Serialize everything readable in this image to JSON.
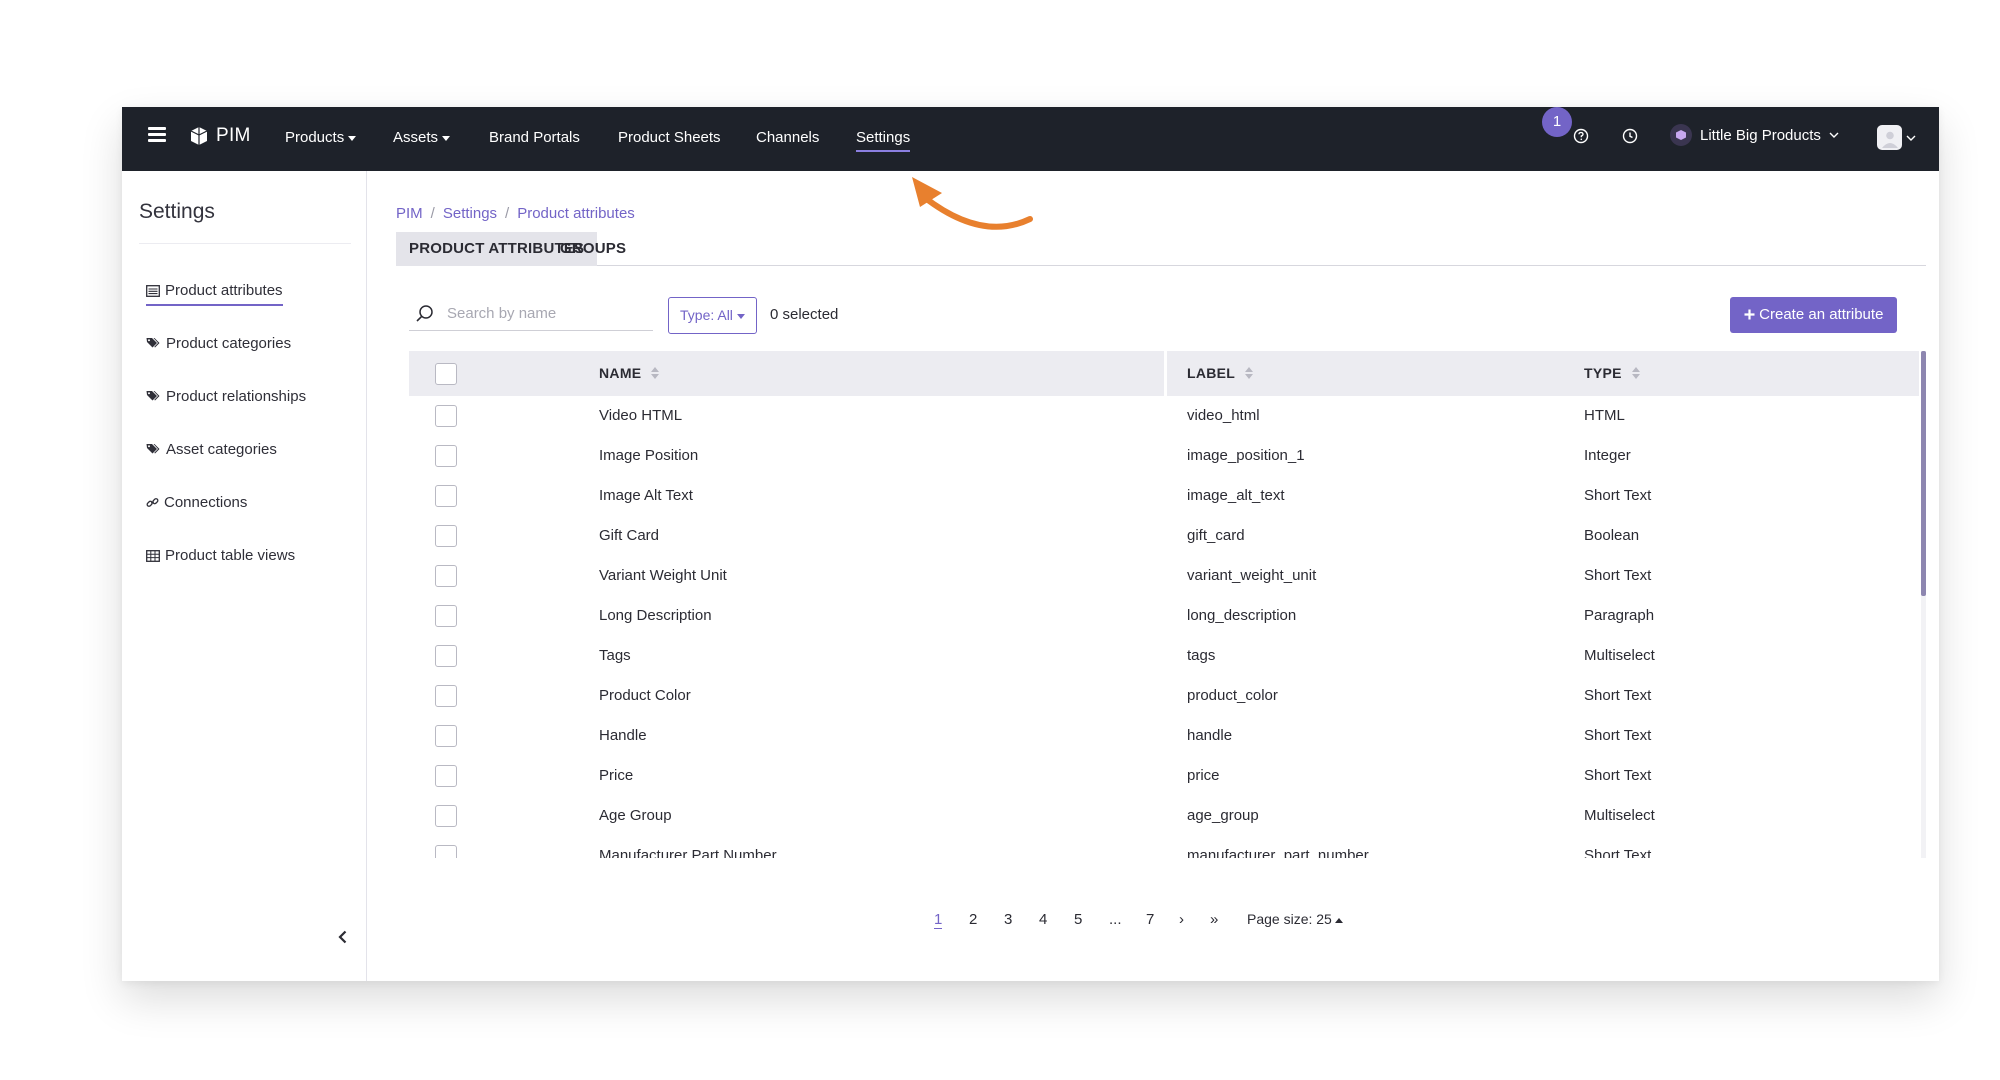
{
  "topnav": {
    "app_name": "PIM",
    "items": [
      {
        "label": "Products",
        "has_caret": true
      },
      {
        "label": "Assets",
        "has_caret": true
      },
      {
        "label": "Brand Portals"
      },
      {
        "label": "Product Sheets"
      },
      {
        "label": "Channels"
      },
      {
        "label": "Settings",
        "active": true
      }
    ],
    "notification_count": "1",
    "workspace": "Little Big Products",
    "icons": [
      "menu-icon",
      "pim-logo-icon",
      "help-icon",
      "history-icon",
      "workspace-icon",
      "avatar-icon"
    ]
  },
  "sidebar": {
    "title": "Settings",
    "items": [
      {
        "label": "Product attributes",
        "icon": "list-icon",
        "active": true
      },
      {
        "label": "Product categories",
        "icon": "tags-icon"
      },
      {
        "label": "Product relationships",
        "icon": "tags-icon"
      },
      {
        "label": "Asset categories",
        "icon": "tags-icon"
      },
      {
        "label": "Connections",
        "icon": "link-icon"
      },
      {
        "label": "Product table views",
        "icon": "table-icon"
      }
    ]
  },
  "breadcrumb": [
    "PIM",
    "Settings",
    "Product attributes"
  ],
  "tabs": [
    {
      "label": "PRODUCT ATTRIBUTES",
      "active": true
    },
    {
      "label": "GROUPS"
    }
  ],
  "toolbar": {
    "search_placeholder": "Search by name",
    "type_filter": "Type: All",
    "selected_count": "0 selected",
    "create_label": "Create an attribute"
  },
  "table": {
    "columns": [
      "NAME",
      "LABEL",
      "TYPE"
    ],
    "rows": [
      {
        "name": "Video HTML",
        "label": "video_html",
        "type": "HTML"
      },
      {
        "name": "Image Position",
        "label": "image_position_1",
        "type": "Integer"
      },
      {
        "name": "Image Alt Text",
        "label": "image_alt_text",
        "type": "Short Text"
      },
      {
        "name": "Gift Card",
        "label": "gift_card",
        "type": "Boolean"
      },
      {
        "name": "Variant Weight Unit",
        "label": "variant_weight_unit",
        "type": "Short Text"
      },
      {
        "name": "Long Description",
        "label": "long_description",
        "type": "Paragraph"
      },
      {
        "name": "Tags",
        "label": "tags",
        "type": "Multiselect"
      },
      {
        "name": "Product Color",
        "label": "product_color",
        "type": "Short Text"
      },
      {
        "name": "Handle",
        "label": "handle",
        "type": "Short Text"
      },
      {
        "name": "Price",
        "label": "price",
        "type": "Short Text"
      },
      {
        "name": "Age Group",
        "label": "age_group",
        "type": "Multiselect"
      },
      {
        "name": "Manufacturer Part Number",
        "label": "manufacturer_part_number",
        "type": "Short Text"
      }
    ]
  },
  "pagination": {
    "pages": [
      "1",
      "2",
      "3",
      "4",
      "5",
      "...",
      "7"
    ],
    "current": "1",
    "next": "›",
    "last": "»",
    "page_size": "Page size: 25"
  },
  "colors": {
    "accent": "#7364c7",
    "nav_bg": "#1e222a",
    "arrow": "#e8802e"
  }
}
